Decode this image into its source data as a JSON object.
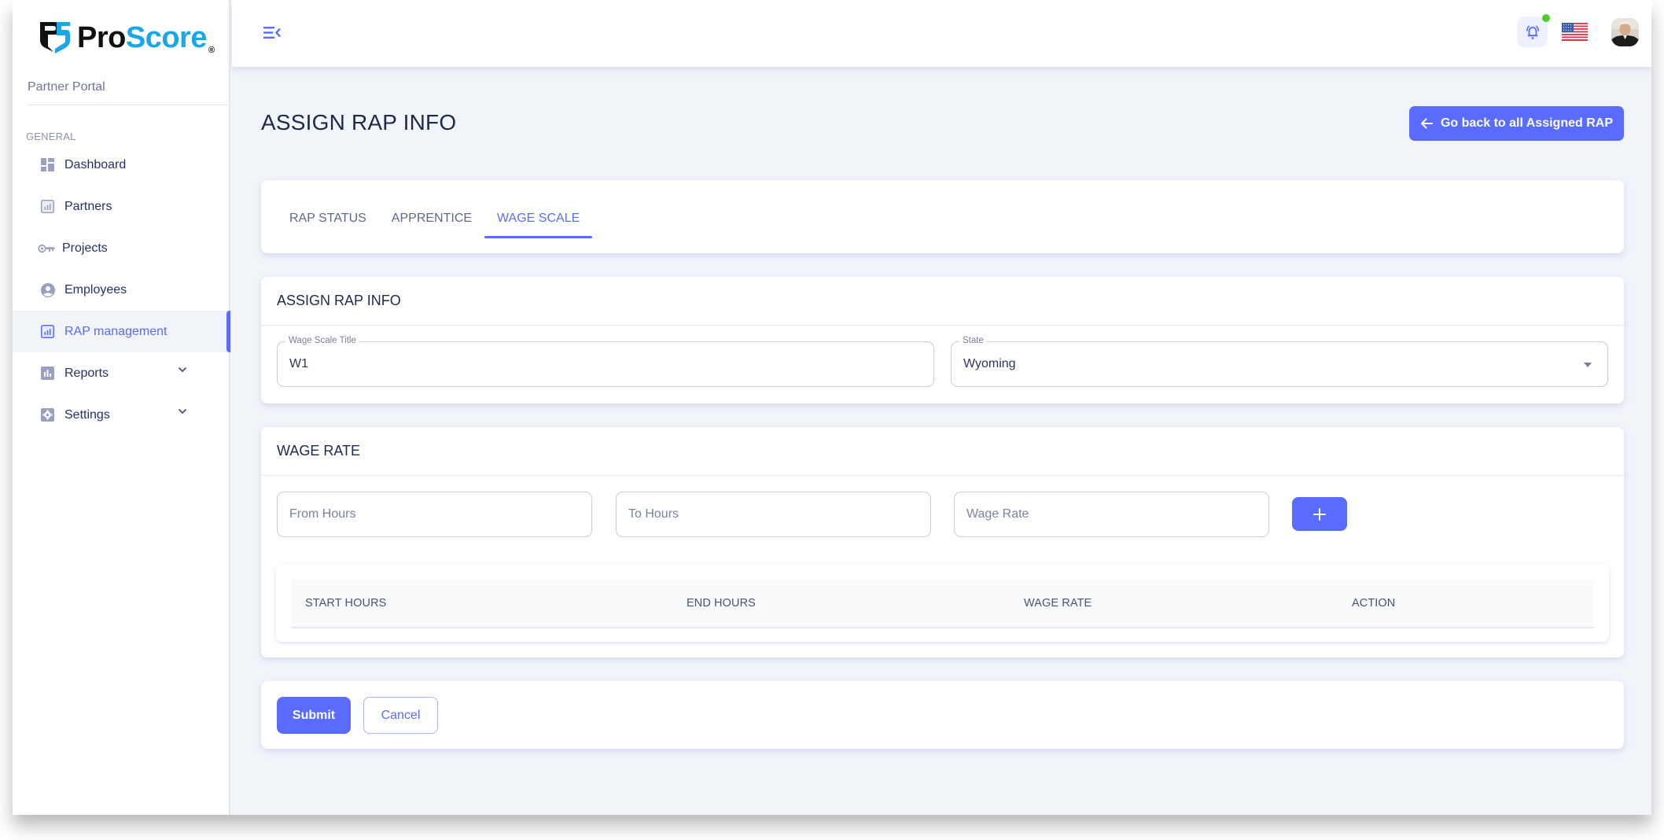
{
  "brand": {
    "name_part1": "Pro",
    "name_part2": "Score",
    "registered": "®",
    "subtitle": "Partner Portal",
    "colors": {
      "dark": "#111111",
      "accent": "#1aa7e8"
    }
  },
  "sidebar": {
    "section_label": "GENERAL",
    "items": [
      {
        "label": "Dashboard",
        "icon": "dashboard-icon",
        "active": false,
        "expandable": false
      },
      {
        "label": "Partners",
        "icon": "bar-chart-box-icon",
        "active": false,
        "expandable": false
      },
      {
        "label": "Projects",
        "icon": "key-icon",
        "active": false,
        "expandable": false
      },
      {
        "label": "Employees",
        "icon": "user-circle-icon",
        "active": false,
        "expandable": false
      },
      {
        "label": "RAP management",
        "icon": "bar-chart-box-icon",
        "active": true,
        "expandable": false
      },
      {
        "label": "Reports",
        "icon": "report-chart-icon",
        "active": false,
        "expandable": true
      },
      {
        "label": "Settings",
        "icon": "settings-gear-icon",
        "active": false,
        "expandable": true
      }
    ]
  },
  "header": {
    "menu_toggle_icon": "menu-collapse-icon",
    "notifications_icon": "bell-icon",
    "notification_status_color": "#4ccf2c",
    "language_flag": "us-flag-icon",
    "avatar_icon": "user-avatar"
  },
  "page": {
    "title": "ASSIGN RAP INFO",
    "back_button_label": "Go back to all Assigned RAP",
    "accent_color": "#5a6bff"
  },
  "tabs": [
    {
      "label": "RAP STATUS",
      "active": false
    },
    {
      "label": "APPRENTICE",
      "active": false
    },
    {
      "label": "WAGE SCALE",
      "active": true
    }
  ],
  "assign_section": {
    "header": "ASSIGN RAP INFO",
    "wage_scale_title": {
      "label": "Wage Scale Title",
      "value": "W1"
    },
    "state": {
      "label": "State",
      "value": "Wyoming"
    }
  },
  "wage_rate_section": {
    "header": "WAGE RATE",
    "from_hours_placeholder": "From Hours",
    "to_hours_placeholder": "To Hours",
    "wage_rate_placeholder": "Wage Rate",
    "add_button_icon": "plus-icon",
    "table": {
      "columns": [
        "START HOURS",
        "END HOURS",
        "WAGE RATE",
        "ACTION"
      ],
      "rows": []
    }
  },
  "actions": {
    "submit_label": "Submit",
    "cancel_label": "Cancel"
  }
}
